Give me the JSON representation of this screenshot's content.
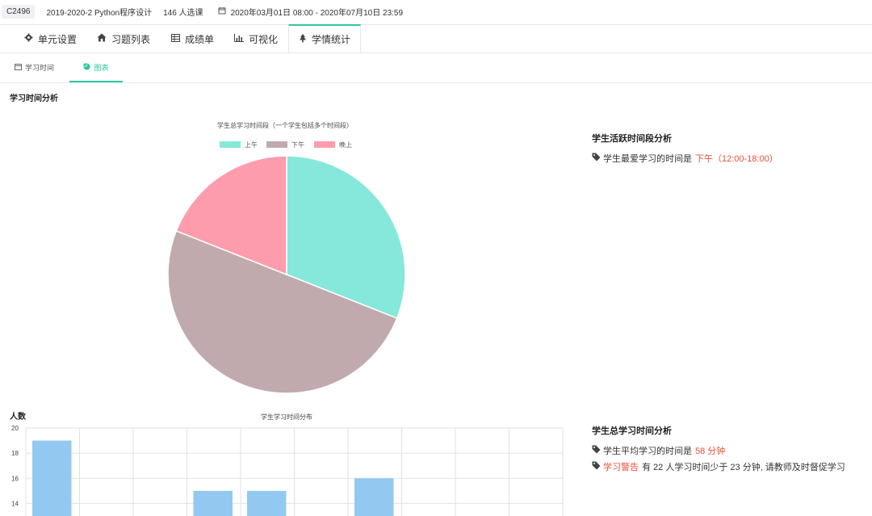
{
  "header": {
    "course_code": "C2496",
    "course_name": "2019-2020-2 Python程序设计",
    "students": "146 人选课",
    "date_range": "2020年03月01日 08:00 - 2020年07月10日 23:59"
  },
  "tabs": [
    {
      "label": "单元设置",
      "icon": "gear-icon"
    },
    {
      "label": "习题列表",
      "icon": "home-icon"
    },
    {
      "label": "成绩单",
      "icon": "table-icon"
    },
    {
      "label": "可视化",
      "icon": "bar-chart-icon"
    },
    {
      "label": "学情统计",
      "icon": "tree-icon"
    }
  ],
  "subtabs": [
    {
      "label": "学习时间",
      "icon": "calendar-icon"
    },
    {
      "label": "图表",
      "icon": "pie-chart-icon"
    }
  ],
  "section_title": "学习时间分析",
  "pie": {
    "title": "学生总学习时间段（一个学生包括多个时间段）"
  },
  "bar": {
    "title": "学生学习时间分布",
    "ylabel": "人数"
  },
  "chart_data": [
    {
      "type": "pie",
      "title": "学生总学习时间段（一个学生包括多个时间段）",
      "legend_position": "top",
      "categories": [
        "上午",
        "下午",
        "晚上"
      ],
      "values": [
        31,
        50,
        19
      ],
      "colors": [
        "#86e8da",
        "#c1aaae",
        "#fd9cad"
      ]
    },
    {
      "type": "bar",
      "title": "学生学习时间分布",
      "ylabel": "人数",
      "xlabel": "",
      "yticks": [
        14,
        16,
        18,
        20
      ],
      "ylim": [
        13,
        20
      ],
      "values": [
        19,
        null,
        null,
        15,
        15,
        null,
        16,
        null,
        null,
        null
      ],
      "color": "#93c9f1",
      "grid": true
    }
  ],
  "right_panel": {
    "active_title": "学生活跃时间段分析",
    "active_prefix": "学生最爱学习的时间是",
    "active_value": "下午（12:00-18:00）",
    "total_title": "学生总学习时间分析",
    "avg_prefix": "学生平均学习的时间是",
    "avg_value": "58 分钟",
    "warning_label": "学习警告",
    "warning_text": "有 22 人学习时间少于 23 分钟, 请教师及时督促学习"
  }
}
